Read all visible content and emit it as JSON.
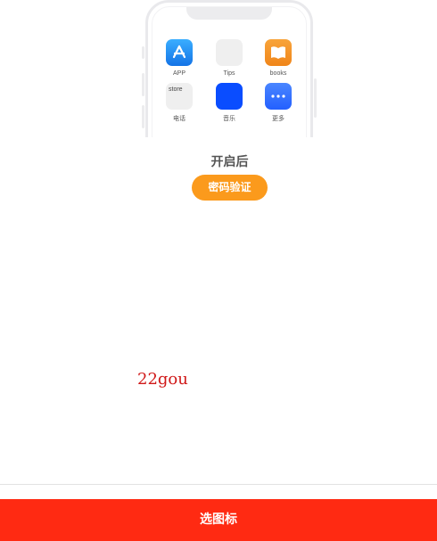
{
  "phone": {
    "apps": [
      {
        "label": "APP",
        "icon": "app-store-icon",
        "color": "#1a8cf0"
      },
      {
        "label": "Tips",
        "icon": "blank-tile-icon",
        "color": "#eeeeee"
      },
      {
        "label": "books",
        "icon": "books-icon",
        "color": "#f5901e"
      },
      {
        "label": "电话",
        "icon": "blank-tile-icon",
        "color": "#eeeeee",
        "tile_text": "store"
      },
      {
        "label": "音乐",
        "icon": "music-tile-icon",
        "color": "#0a4dff"
      },
      {
        "label": "更多",
        "icon": "more-icon",
        "color": "#2e6dff"
      }
    ]
  },
  "after_title": "开启后",
  "password_button": {
    "label": "密码验证",
    "color": "#fb9a1c"
  },
  "watermark": "22gou",
  "bottom_bar": {
    "label": "选图标",
    "color": "#ff2a12"
  }
}
